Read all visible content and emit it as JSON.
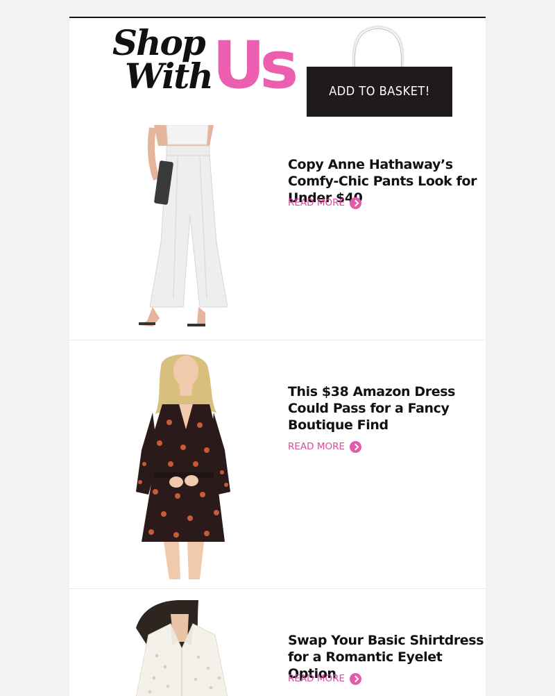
{
  "header": {
    "logo_shop": "Shop",
    "logo_with": "With",
    "logo_us": "Us",
    "basket_label": "ADD TO BASKET!"
  },
  "articles": [
    {
      "headline": "Copy Anne Hathaway’s Comfy-Chic Pants Look for Under $40",
      "read_more": "READ MORE"
    },
    {
      "headline": "This $38 Amazon Dress Could Pass for a Fancy Boutique Find",
      "read_more": "READ MORE"
    },
    {
      "headline": "Swap Your Basic Shirtdress for a Romantic Eyelet Option",
      "read_more": "READ MORE"
    }
  ],
  "colors": {
    "accent": "#e35aa8",
    "link": "#d94c9d",
    "brand_pink": "#ec5fae",
    "bag": "#1f1b1c",
    "text": "#111111"
  },
  "icons": {
    "read_more": "chevron-right-circle-icon",
    "bag": "shopping-bag-icon"
  }
}
